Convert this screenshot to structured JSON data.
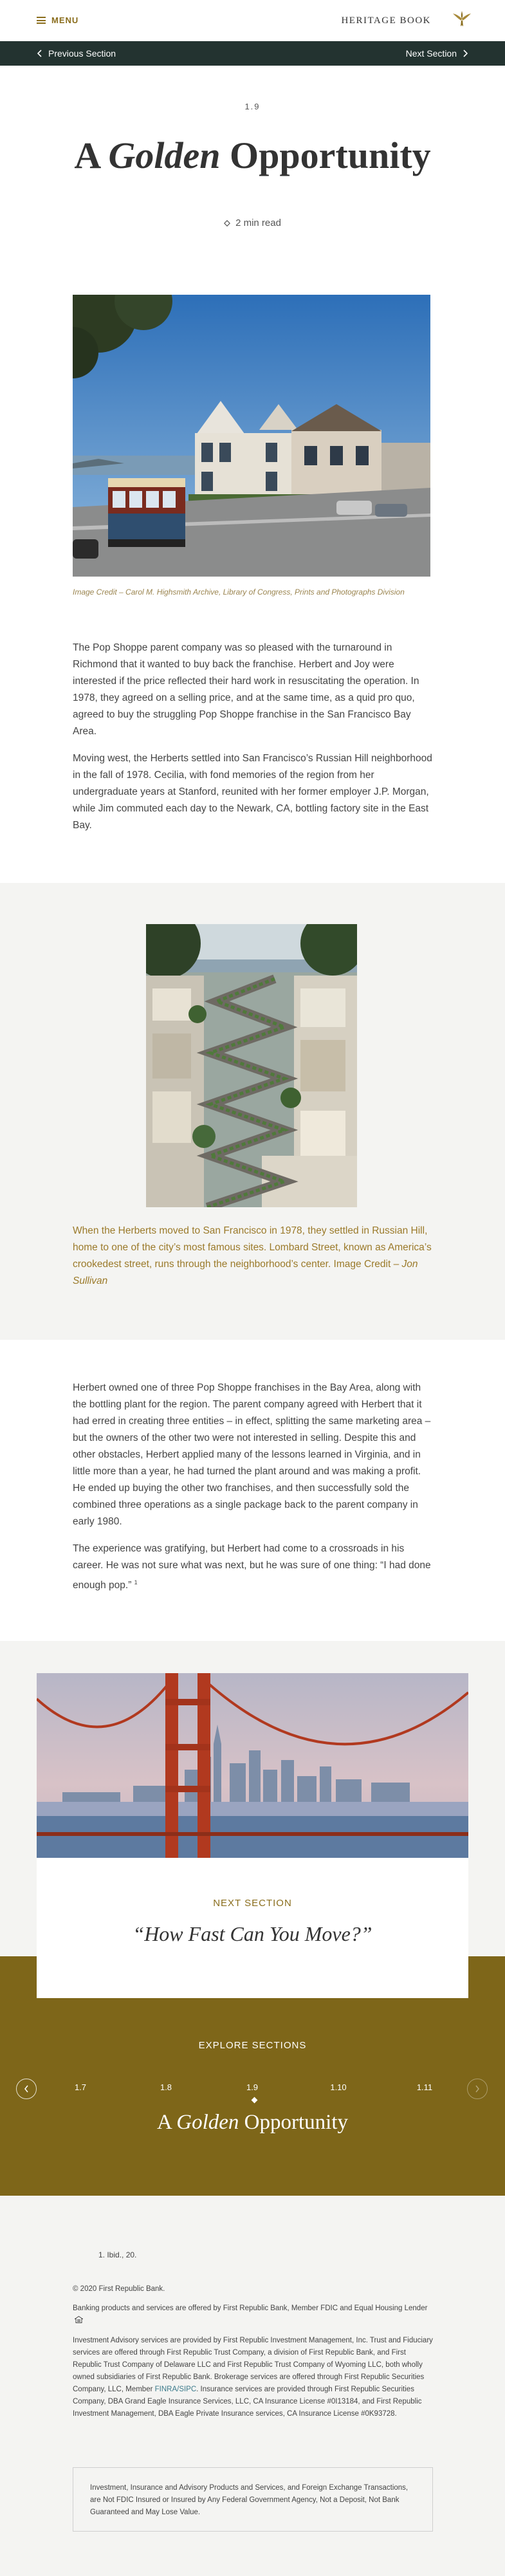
{
  "header": {
    "menu_label": "MENU",
    "brand": "HERITAGE BOOK"
  },
  "section_nav": {
    "prev_label": "Previous Section",
    "next_label": "Next Section"
  },
  "article": {
    "section_number": "1.9",
    "title_pre": "A ",
    "title_em": "Golden",
    "title_post": " Opportunity",
    "read_time": "2 min read",
    "hero_caption": "Image Credit – Carol M. Highsmith Archive, Library of Congress, Prints and Photographs Division",
    "paragraphs_1": [
      "The Pop Shoppe parent company was so pleased with the turnaround in Richmond that it wanted to buy back the franchise. Herbert and Joy were interested if the price reflected their hard work in resuscitating the operation. In 1978, they agreed on a selling price, and at the same time, as a quid pro quo, agreed to buy the struggling Pop Shoppe franchise in the San Francisco Bay Area.",
      "Moving west, the Herberts settled into San Francisco’s Russian Hill neighborhood in the fall of 1978. Cecilia, with fond memories of the region from her undergraduate years at Stanford, reunited with her former employer J.P. Morgan, while Jim commuted each day to the Newark, CA, bottling factory site in the East Bay."
    ],
    "photo2_caption_text": "When the Herberts moved to San Francisco in 1978, they settled in Russian Hill, home to one of the city’s most famous sites. Lombard Street, known as America’s crookedest street, runs through the neighborhood’s center. Image Credit – ",
    "photo2_caption_credit": "Jon Sullivan",
    "paragraphs_2": [
      "Herbert owned one of three Pop Shoppe franchises in the Bay Area, along with the bottling plant for the region. The parent company agreed with Herbert that it had erred in creating three entities – in effect, splitting the same marketing area – but the owners of the other two were not interested in selling. Despite this and other obstacles, Herbert applied many of the lessons learned in Virginia, and in little more than a year, he had turned the plant around and was making a profit. He ended up buying the other two franchises, and then successfully sold the combined three operations as a single package back to the parent company in early 1980.",
      "The experience was gratifying, but Herbert had come to a crossroads in his career. He was not sure what was next, but he was sure of one thing: “I had done enough pop.”"
    ],
    "footnote_ref": "1"
  },
  "next_section": {
    "label": "NEXT SECTION",
    "title": "“How Fast Can You Move?”"
  },
  "explore": {
    "label": "EXPLORE SECTIONS",
    "tabs": [
      "1.7",
      "1.8",
      "1.9",
      "1.10",
      "1.11"
    ],
    "current_title_pre": "A ",
    "current_title_em": "Golden",
    "current_title_post": " Opportunity"
  },
  "footer": {
    "footnote": "1.   Ibid., 20.",
    "copyright": "© 2020 First Republic Bank.",
    "banking_notice": "Banking products and services are offered by First Republic Bank, Member FDIC and Equal Housing Lender",
    "investment_notice_1": "Investment Advisory services are provided by First Republic Investment Management, Inc. Trust and Fiduciary services are offered through First Republic Trust Company, a division of First Republic Bank, and First Republic Trust Company of Delaware LLC and First Republic Trust Company of Wyoming LLC, both wholly owned subsidiaries of First Republic Bank. Brokerage services are offered through First Republic Securities Company, LLC, Member ",
    "finra_link": "FINRA/SIPC",
    "investment_notice_2": ". Insurance services are provided through First Republic Securities Company, DBA Grand Eagle Insurance Services, LLC, CA Insurance License #0I13184, and First Republic Investment Management, DBA Eagle Private Insurance services, CA Insurance License #0K93728.",
    "box_notice": "Investment, Insurance and Advisory Products and Services, and Foreign Exchange Transactions, are Not FDIC Insured or Insured by Any Federal Government Agency, Not a Deposit, Not Bank Guaranteed and May Lose Value."
  },
  "colors": {
    "gold": "#7e6619",
    "accent_text": "#8a6d1c",
    "nav_bar": "#233330",
    "band_bg": "#f4f4f2"
  }
}
